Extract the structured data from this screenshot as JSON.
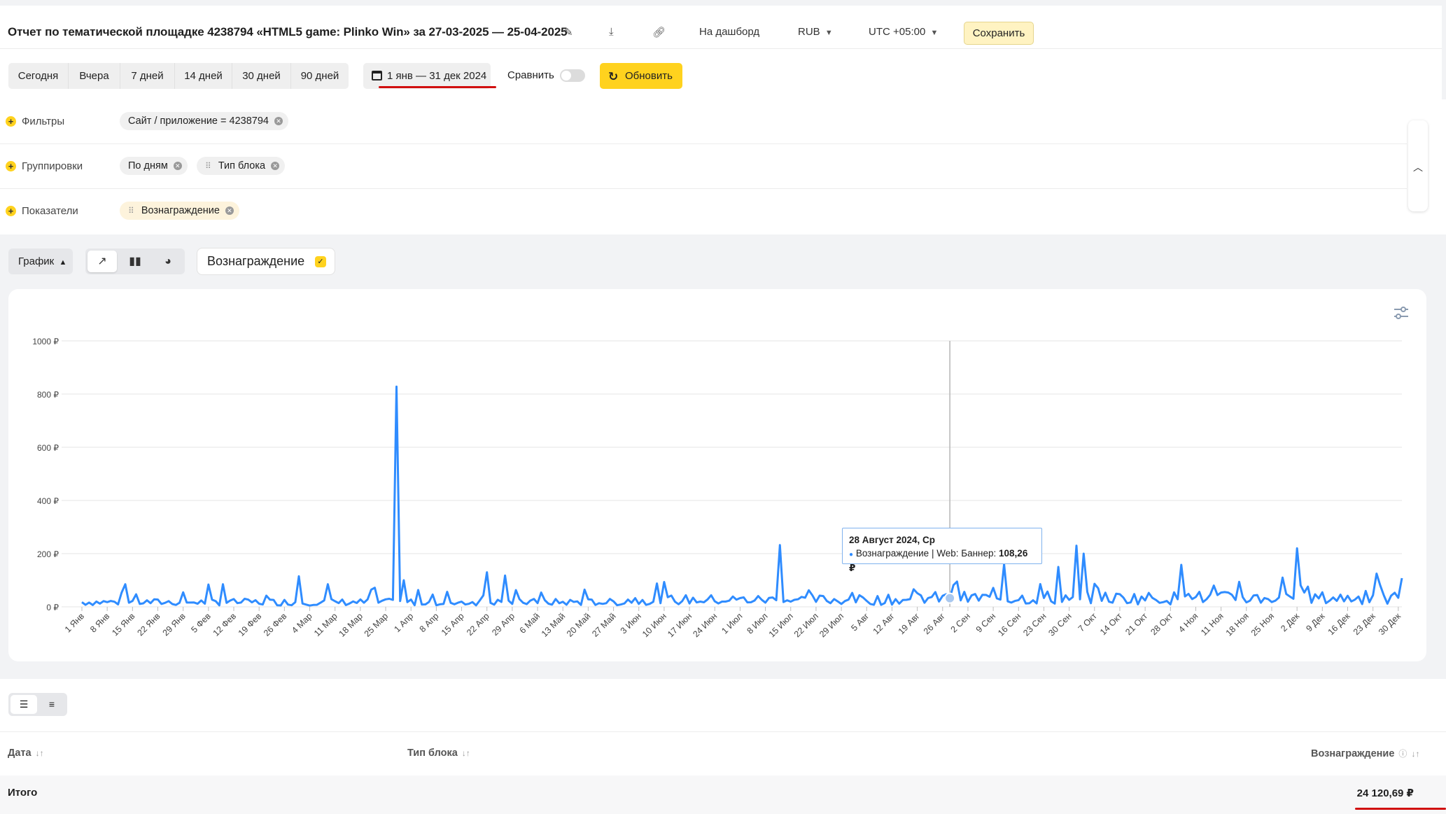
{
  "header": {
    "title": "Отчет по тематической площадке 4238794 «HTML5 game: Plinko Win» за 27-03-2025 — 25-04-2025",
    "to_dashboard": "На дашборд",
    "currency": "RUB",
    "timezone": "UTC +05:00",
    "save_label": "Сохранить"
  },
  "periods": {
    "presets": [
      "Сегодня",
      "Вчера",
      "7 дней",
      "14 дней",
      "30 дней",
      "90 дней"
    ],
    "date_range": "1 янв — 31 дек 2024",
    "compare_label": "Сравнить",
    "refresh_label": "Обновить"
  },
  "setup": {
    "filters_label": "Фильтры",
    "filter_chip": "Сайт / приложение = 4238794",
    "groupings_label": "Группировки",
    "grouping_chips": [
      "По дням",
      "Тип блока"
    ],
    "metrics_label": "Показатели",
    "metric_chip": "Вознаграждение"
  },
  "chart_toolbar": {
    "view_label": "График",
    "series_label": "Вознаграждение"
  },
  "tooltip": {
    "date": "28 Август 2024, Ср",
    "series": "Вознаграждение | Web: Баннер:",
    "value": "108,26 ₽"
  },
  "chart_data": {
    "type": "line",
    "ylim": [
      0,
      1000
    ],
    "yticks": [
      "0 ₽",
      "200 ₽",
      "400 ₽",
      "600 ₽",
      "800 ₽",
      "1000 ₽"
    ],
    "xticks": [
      "1 Янв",
      "8 Янв",
      "15 Янв",
      "22 Янв",
      "29 Янв",
      "5 Фев",
      "12 Фев",
      "19 Фев",
      "26 Фев",
      "4 Мар",
      "11 Мар",
      "18 Мар",
      "25 Мар",
      "1 Апр",
      "8 Апр",
      "15 Апр",
      "22 Апр",
      "29 Апр",
      "6 Май",
      "13 Май",
      "20 Май",
      "27 Май",
      "3 Июн",
      "10 Июн",
      "17 Июн",
      "24 Июн",
      "1 Июл",
      "8 Июл",
      "15 Июл",
      "22 Июл",
      "29 Июл",
      "5 Авг",
      "12 Авг",
      "19 Авг",
      "26 Авг",
      "2 Сен",
      "9 Сен",
      "16 Сен",
      "23 Сен",
      "30 Сен",
      "7 Окт",
      "14 Окт",
      "21 Окт",
      "28 Окт",
      "4 Ноя",
      "11 Ноя",
      "18 Ноя",
      "25 Ноя",
      "2 Дек",
      "9 Дек",
      "16 Дек",
      "23 Дек",
      "30 Дек"
    ],
    "days": 366,
    "hover_day": 240,
    "color": "#2f8cff",
    "spikes": [
      [
        12,
        85
      ],
      [
        39,
        85
      ],
      [
        51,
        42
      ],
      [
        60,
        115
      ],
      [
        68,
        85
      ],
      [
        87,
        828
      ],
      [
        89,
        100
      ],
      [
        112,
        130
      ],
      [
        117,
        118
      ],
      [
        193,
        232
      ],
      [
        242,
        95
      ],
      [
        255,
        160
      ],
      [
        270,
        150
      ],
      [
        275,
        230
      ],
      [
        277,
        200
      ],
      [
        281,
        70
      ],
      [
        304,
        158
      ],
      [
        313,
        80
      ],
      [
        320,
        94
      ],
      [
        332,
        110
      ],
      [
        336,
        220
      ],
      [
        358,
        125
      ],
      [
        365,
        108
      ]
    ],
    "series_values_base": 20
  },
  "table": {
    "col_date": "Дата",
    "col_block_type": "Тип блока",
    "col_reward": "Вознаграждение",
    "total_label": "Итого",
    "total_value": "24 120,69 ₽"
  }
}
